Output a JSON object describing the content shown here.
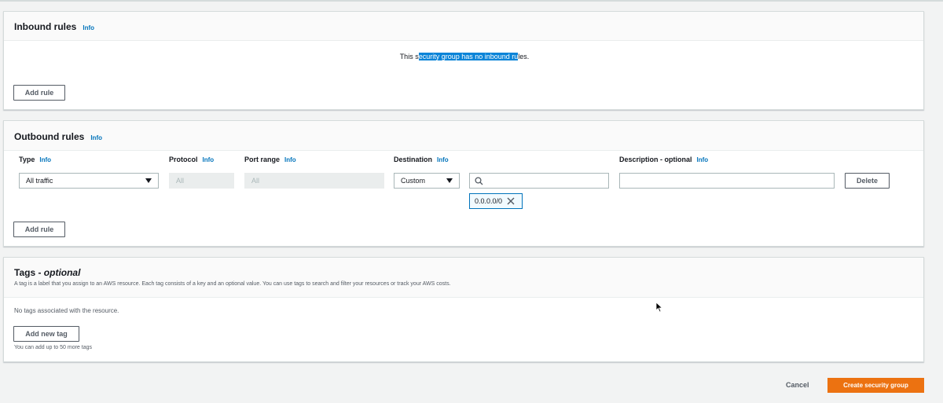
{
  "inbound": {
    "title": "Inbound rules",
    "info": "Info",
    "empty_pre": "This s",
    "empty_highlight": "ecurity group has no inbound ru",
    "empty_post": "les.",
    "add_rule": "Add rule"
  },
  "outbound": {
    "title": "Outbound rules",
    "info": "Info",
    "columns": {
      "type": "Type",
      "protocol": "Protocol",
      "port_range": "Port range",
      "destination": "Destination",
      "description": "Description - optional",
      "info": "Info"
    },
    "row": {
      "type_value": "All traffic",
      "protocol_value": "All",
      "port_value": "All",
      "destination_value": "Custom",
      "search_value": "",
      "cidr_token": "0.0.0.0/0",
      "description_value": "",
      "delete": "Delete"
    },
    "add_rule": "Add rule"
  },
  "tags": {
    "title": "Tags - ",
    "title_optional": "optional",
    "description": "A tag is a label that you assign to an AWS resource. Each tag consists of a key and an optional value. You can use tags to search and filter your resources or track your AWS costs.",
    "empty": "No tags associated with the resource.",
    "add_tag": "Add new tag",
    "limit_note": "You can add up to 50 more tags"
  },
  "footer": {
    "cancel": "Cancel",
    "create": "Create security group"
  },
  "colors": {
    "primary": "#ec7211",
    "link": "#0073bb",
    "highlight": "#0a84d8"
  }
}
